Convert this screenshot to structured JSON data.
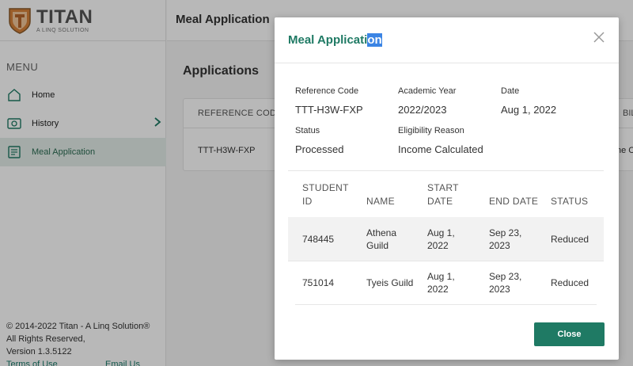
{
  "brand": {
    "title": "TITAN",
    "subtitle": "A LINQ SOLUTION",
    "shield_letter": "T",
    "accent_color": "#d6813a"
  },
  "sidebar": {
    "menu_label": "MENU",
    "items": [
      {
        "label": "Home",
        "icon": "home-icon"
      },
      {
        "label": "History",
        "icon": "history-icon"
      },
      {
        "label": "Meal Application",
        "icon": "document-icon"
      }
    ],
    "footer": {
      "copyright": "© 2014-2022 Titan - A Linq Solution® All Rights Reserved,",
      "version": "Version 1.3.5122",
      "terms": "Terms of Use",
      "email": "Email Us"
    }
  },
  "topbar": {
    "title": "Meal Application"
  },
  "main": {
    "heading": "Applications",
    "table": {
      "header_first": "REFERENCE CODE",
      "header_last_partial": "BILI",
      "row_first": "TTT-H3W-FXP",
      "row_last_partial": "ne C"
    }
  },
  "modal": {
    "title_unselected": "Meal Applicati",
    "title_selected": "on",
    "fields": {
      "reference_code_label": "Reference Code",
      "reference_code": "TTT-H3W-FXP",
      "academic_year_label": "Academic Year",
      "academic_year": "2022/2023",
      "date_label": "Date",
      "date": "Aug 1, 2022",
      "status_label": "Status",
      "status": "Processed",
      "eligibility_label": "Eligibility Reason",
      "eligibility": "Income Calculated"
    },
    "table": {
      "headers": {
        "student_id_1": "STUDENT",
        "student_id_2": "ID",
        "name": "NAME",
        "start_1": "START",
        "start_2": "DATE",
        "end": "END DATE",
        "status": "STATUS"
      },
      "rows": [
        {
          "id": "748445",
          "name_1": "Athena",
          "name_2": "Guild",
          "start_1": "Aug 1,",
          "start_2": "2022",
          "end_1": "Sep 23,",
          "end_2": "2023",
          "status": "Reduced"
        },
        {
          "id": "751014",
          "name_1": "Tyeis Guild",
          "name_2": "",
          "start_1": "Aug 1,",
          "start_2": "2022",
          "end_1": "Sep 23,",
          "end_2": "2023",
          "status": "Reduced"
        }
      ]
    },
    "close_label": "Close",
    "primary_color": "#1f7a64"
  }
}
